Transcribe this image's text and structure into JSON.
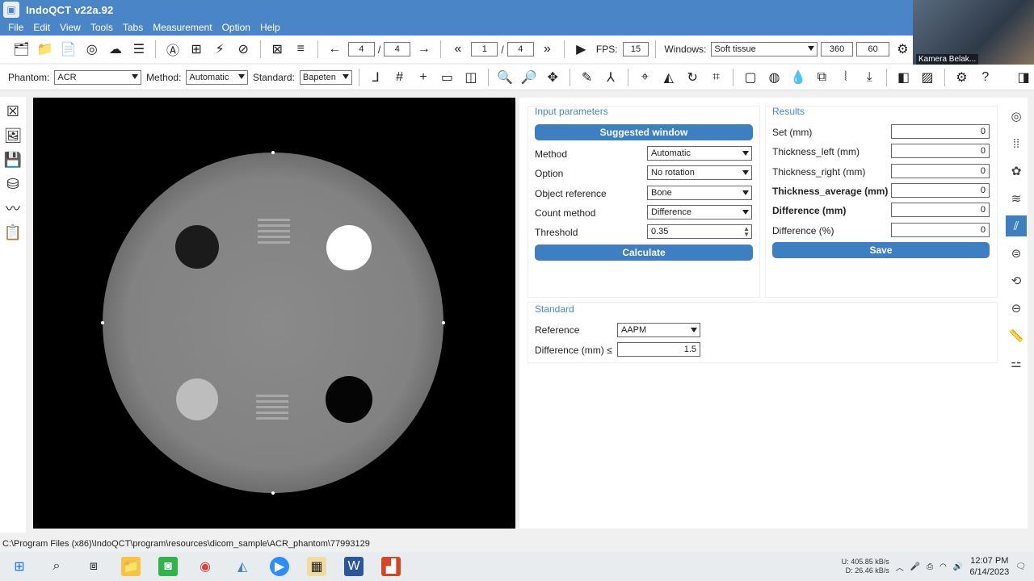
{
  "window": {
    "title": "IndoQCT v22a.92"
  },
  "menu": [
    "File",
    "Edit",
    "View",
    "Tools",
    "Tabs",
    "Measurement",
    "Option",
    "Help"
  ],
  "webcam": {
    "label": "Kamera Belak..."
  },
  "toolbar1": {
    "slice_current": "4",
    "slice_total": "4",
    "series_current": "1",
    "series_total": "4",
    "fps_label": "FPS:",
    "fps_value": "15",
    "windows_label": "Windows:",
    "windows_value": "Soft tissue",
    "window_width": "360",
    "window_level": "60"
  },
  "toolbar2": {
    "phantom_label": "Phantom:",
    "phantom_value": "ACR",
    "method_label": "Method:",
    "method_value": "Automatic",
    "standard_label": "Standard:",
    "standard_value": "Bapeten"
  },
  "input_parameters": {
    "title": "Input parameters",
    "suggested_window_button": "Suggested window",
    "method_label": "Method",
    "method_value": "Automatic",
    "option_label": "Option",
    "option_value": "No rotation",
    "object_reference_label": "Object reference",
    "object_reference_value": "Bone",
    "count_method_label": "Count method",
    "count_method_value": "Difference",
    "threshold_label": "Threshold",
    "threshold_value": "0.35",
    "calculate_button": "Calculate"
  },
  "results": {
    "title": "Results",
    "rows": [
      {
        "label": "Set (mm)",
        "value": "0",
        "bold": false
      },
      {
        "label": "Thickness_left (mm)",
        "value": "0",
        "bold": false
      },
      {
        "label": "Thickness_right (mm)",
        "value": "0",
        "bold": false
      },
      {
        "label": "Thickness_average (mm)",
        "value": "0",
        "bold": true
      },
      {
        "label": "Difference (mm)",
        "value": "0",
        "bold": true
      },
      {
        "label": "Difference (%)",
        "value": "0",
        "bold": false
      }
    ],
    "save_button": "Save"
  },
  "standard": {
    "title": "Standard",
    "reference_label": "Reference",
    "reference_value": "AAPM",
    "difference_label": "Difference (mm) ≤",
    "difference_value": "1.5"
  },
  "statusbar": {
    "path": "C:\\Program Files (x86)\\IndoQCT\\program\\resources\\dicom_sample\\ACR_phantom\\77993129"
  },
  "tray": {
    "upload": "405.85 kB/s",
    "download": "26.46 kB/s",
    "upload_prefix": "U:",
    "download_prefix": "D:",
    "time": "12:07 PM",
    "date": "6/14/2023"
  },
  "colors": {
    "accent": "#3d7fc0",
    "titlebar": "#4a86c7",
    "viewer_bg": "#000000"
  }
}
